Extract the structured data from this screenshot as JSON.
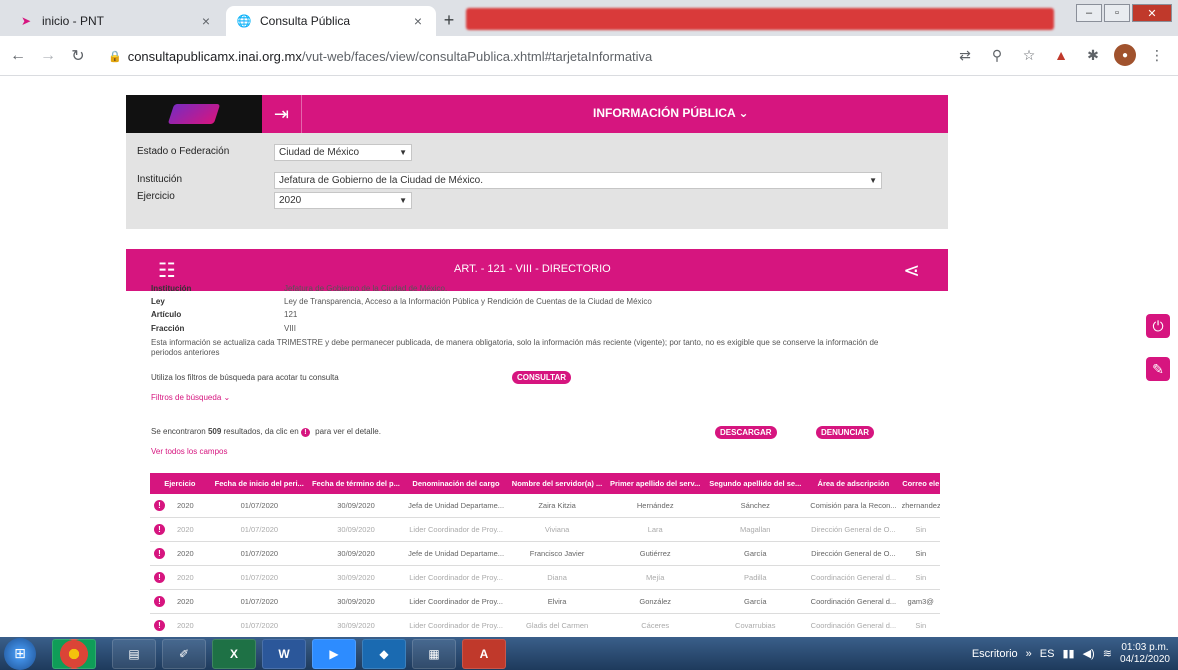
{
  "browser": {
    "tabs": [
      {
        "title": "inicio - PNT",
        "close": "×"
      },
      {
        "title": "Consulta Pública",
        "close": "×"
      }
    ],
    "new_tab": "+",
    "url_host": "consultapublicamx.inai.org.mx",
    "url_path": "/vut-web/faces/view/consultaPublica.xhtml#tarjetaInformativa"
  },
  "header": {
    "menu_title": "INFORMACIÓN PÚBLICA ⌄"
  },
  "filters": {
    "estado_label": "Estado o Federación",
    "estado_value": "Ciudad de México",
    "institucion_label": "Institución",
    "institucion_value": "Jefatura de Gobierno de la Ciudad de México.",
    "ejercicio_label": "Ejercicio",
    "ejercicio_value": "2020"
  },
  "article": {
    "title": "ART. - 121 - VIII - DIRECTORIO"
  },
  "info": {
    "institucion_k": "Institución",
    "institucion_v": "Jefatura de Gobierno de la Ciudad de México.",
    "ley_k": "Ley",
    "ley_v": "Ley de Transparencia, Acceso a la Información Pública y Rendición de Cuentas de la Ciudad de México",
    "articulo_k": "Artículo",
    "articulo_v": "121",
    "fraccion_k": "Fracción",
    "fraccion_v": "VIII",
    "notice": "Esta información se actualiza cada TRIMESTRE y debe permanecer publicada, de manera obligatoria, solo la información más reciente (vigente); por tanto, no es exigible que se conserve la información de periodos anteriores"
  },
  "search": {
    "hint": "Utiliza los filtros de búsqueda para acotar tu consulta",
    "consultar": "CONSULTAR",
    "filtros_link": "Filtros de búsqueda ⌄",
    "results_prefix": "Se encontraron ",
    "results_count": "509",
    "results_suffix": " resultados, da clic en ",
    "results_end": " para ver el detalle.",
    "descargar": "DESCARGAR",
    "denunciar": "DENUNCIAR",
    "ver_todos": "Ver todos los campos"
  },
  "table": {
    "headers": [
      "Ejercicio",
      "Fecha de inicio del peri...",
      "Fecha de término del p...",
      "Denominación del cargo",
      "Nombre del servidor(a) ...",
      "Primer apellido del serv...",
      "Segundo apellido del se...",
      "Área de adscripción",
      "Correo ele"
    ],
    "rows": [
      [
        "2020",
        "01/07/2020",
        "30/09/2020",
        "Jefa de Unidad Departame...",
        "Zaira Kitzia",
        "Hernández",
        "Sánchez",
        "Comisión para la Recon...",
        "zhernandez"
      ],
      [
        "2020",
        "01/07/2020",
        "30/09/2020",
        "Lider Coordinador de Proy...",
        "Viviana",
        "Lara",
        "Magallan",
        "Dirección General de O...",
        "Sin"
      ],
      [
        "2020",
        "01/07/2020",
        "30/09/2020",
        "Jefe de Unidad Departame...",
        "Francisco Javier",
        "Gutiérrez",
        "García",
        "Dirección General de O...",
        "Sin"
      ],
      [
        "2020",
        "01/07/2020",
        "30/09/2020",
        "Lider Coordinador de Proy...",
        "Diana",
        "Mejía",
        "Padilla",
        "Coordinación General d...",
        "Sin"
      ],
      [
        "2020",
        "01/07/2020",
        "30/09/2020",
        "Lider Coordinador de Proy...",
        "Elvira",
        "González",
        "García",
        "Coordinación General d...",
        "gam3@"
      ],
      [
        "2020",
        "01/07/2020",
        "30/09/2020",
        "Lider Coordinador de Proy...",
        "Gladis del Carmen",
        "Cáceres",
        "Covarrubias",
        "Coordinación General d...",
        "Sin"
      ]
    ]
  },
  "taskbar": {
    "escritorio": "Escritorio",
    "lang": "ES",
    "time": "01:03 p.m.",
    "date": "04/12/2020"
  },
  "colors": {
    "brand_pink": "#d6157f",
    "filter_bg": "#e3e3e3"
  }
}
